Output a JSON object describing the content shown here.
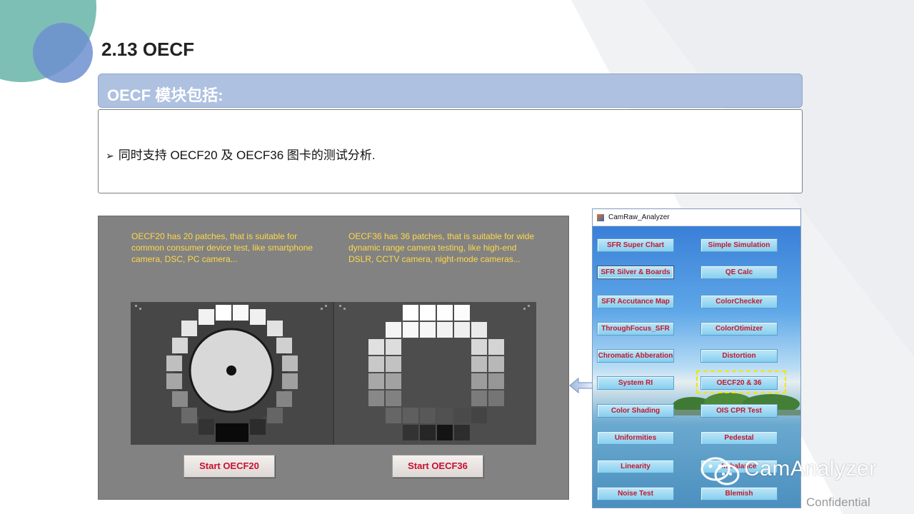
{
  "slide": {
    "title": "2.13  OECF",
    "section_header": "OECF 模块包括:",
    "bullet_arrow": "➢",
    "bullet_text": "同时支持 OECF20 及 OECF36 图卡的测试分析."
  },
  "oecf_panel": {
    "desc_20": "OECF20 has 20 patches, that is suitable for common consumer device test, like smartphone camera, DSC, PC camera...",
    "desc_36": "OECF36 has 36 patches, that is suitable for wide dynamic range camera testing, like high-end DSLR, CCTV camera, night-mode cameras...",
    "start_20_label": "Start OECF20",
    "start_36_label": "Start OECF36"
  },
  "camraw_window": {
    "title": "CamRaw_Analyzer",
    "left_buttons": [
      "SFR Super Chart",
      "SFR Silver & Boards",
      "SFR Accutance Map",
      "ThroughFocus_SFR",
      "Chromatic Abberation",
      "System RI",
      "Color Shading",
      "Uniformities",
      "Linearity",
      "Noise Test"
    ],
    "right_buttons": [
      "Simple Simulation",
      "QE Calc",
      "ColorChecker",
      "ColorOtimizer",
      "Distortion",
      "OECF20 & 36",
      "OIS CPR Test",
      "Pedestal",
      "Imbalance",
      "Blemish"
    ]
  },
  "watermark": "CamAnalyzer",
  "footer": "Confidential",
  "colors": {
    "header_fill": "#aec1e0",
    "panel_bg": "#828282",
    "desc_text": "#ffd84a",
    "button_text": "#c8102e",
    "highlight": "#f2e600",
    "teal_circle": "#6fb8ad",
    "blue_circle": "#6d8fd0"
  }
}
